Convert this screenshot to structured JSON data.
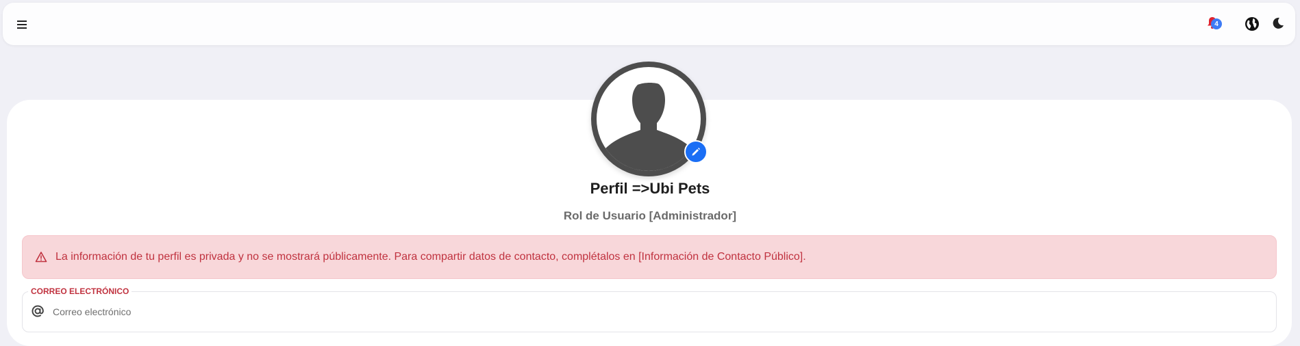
{
  "header": {
    "notification_count": "4",
    "icons": [
      "menu-icon",
      "bell-icon",
      "globe-icon",
      "moon-icon"
    ]
  },
  "profile": {
    "title": "Perfil =>Ubi Pets",
    "role": "Rol de Usuario [Administrador]",
    "avatar_icon": "user-silhouette-icon",
    "edit_icon": "pencil-icon"
  },
  "alert": {
    "icon": "warning-icon",
    "text": "La información de tu perfil es privada y no se mostrará públicamente. Para compartir datos de contacto, complétalos en [Información de Contacto Público]."
  },
  "email_field": {
    "legend": "CORREO ELECTRÓNICO",
    "placeholder": "Correo electrónico",
    "value": "",
    "icon": "at-sign-icon"
  },
  "colors": {
    "background": "#f0f0f6",
    "accent": "#1a6ef5",
    "badge": "#3d7bf5",
    "bell": "#e0242f",
    "alert_bg": "#f8d7da",
    "alert_text": "#c0323f",
    "avatar": "#4d4d4d"
  }
}
